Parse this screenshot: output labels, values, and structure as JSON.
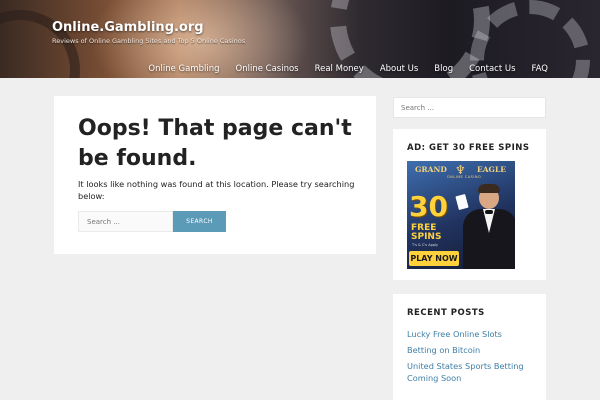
{
  "header": {
    "site_title": "Online.Gambling.org",
    "site_description": "Reviews of Online Gambling Sites and Top 5 Online Casinos",
    "nav": [
      {
        "label": "Online Gambling"
      },
      {
        "label": "Online Casinos"
      },
      {
        "label": "Real Money"
      },
      {
        "label": "About Us"
      },
      {
        "label": "Blog"
      },
      {
        "label": "Contact Us"
      },
      {
        "label": "FAQ"
      }
    ]
  },
  "main": {
    "title": "Oops! That page can't be found.",
    "message": "It looks like nothing was found at this location. Please try searching below:",
    "search_placeholder": "Search ...",
    "search_button": "SEARCH"
  },
  "sidebar": {
    "search_placeholder": "Search ...",
    "ad": {
      "title": "AD: GET 30 FREE SPINS",
      "logo_left": "GRAND",
      "logo_right": "EAGLE",
      "logo_sub": "ONLINE CASINO",
      "number": "30",
      "free": "FREE",
      "spins": "SPINS",
      "terms": "T's & C's Apply",
      "cta": "PLAY NOW"
    },
    "recent_posts": {
      "title": "RECENT POSTS",
      "items": [
        {
          "label": "Lucky Free Online Slots"
        },
        {
          "label": "Betting on Bitcoin"
        },
        {
          "label": "United States Sports Betting Coming Soon"
        }
      ]
    }
  },
  "colors": {
    "accent": "#5b9bb8",
    "link": "#3f7fa6",
    "background": "#efefef"
  }
}
